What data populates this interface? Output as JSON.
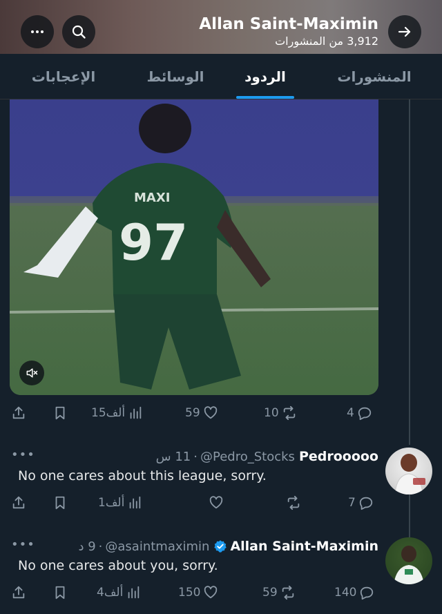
{
  "header": {
    "profile_name": "Allan Saint-Maximin",
    "post_count": "3,912 من المنشورات"
  },
  "tabs": [
    {
      "label": "المنشورات"
    },
    {
      "label": "الردود"
    },
    {
      "label": "الوسائط"
    },
    {
      "label": "الإعجابات"
    }
  ],
  "active_tab": "الردود",
  "video": {
    "jersey_text": "MAXI",
    "jersey_number": "97"
  },
  "post_actions": {
    "replies": "4",
    "reposts": "10",
    "likes": "59",
    "views": "15ألف"
  },
  "tweets": [
    {
      "name": "Pedrooooo",
      "handle": "@Pedro_Stocks",
      "time": "11 س",
      "text": "No one cares about this league, sorry.",
      "replies": "7",
      "reposts": "",
      "likes": "",
      "views": "1ألف"
    },
    {
      "name": "Allan Saint-Maximin",
      "handle": "@asaintmaximin",
      "time": "9 د",
      "text": "No one cares about you, sorry.",
      "verified": true,
      "replies": "140",
      "reposts": "59",
      "likes": "150",
      "views": "4ألف"
    }
  ],
  "colors": {
    "background": "#15202b",
    "accent": "#1d9bf0",
    "muted": "#8b98a5"
  }
}
